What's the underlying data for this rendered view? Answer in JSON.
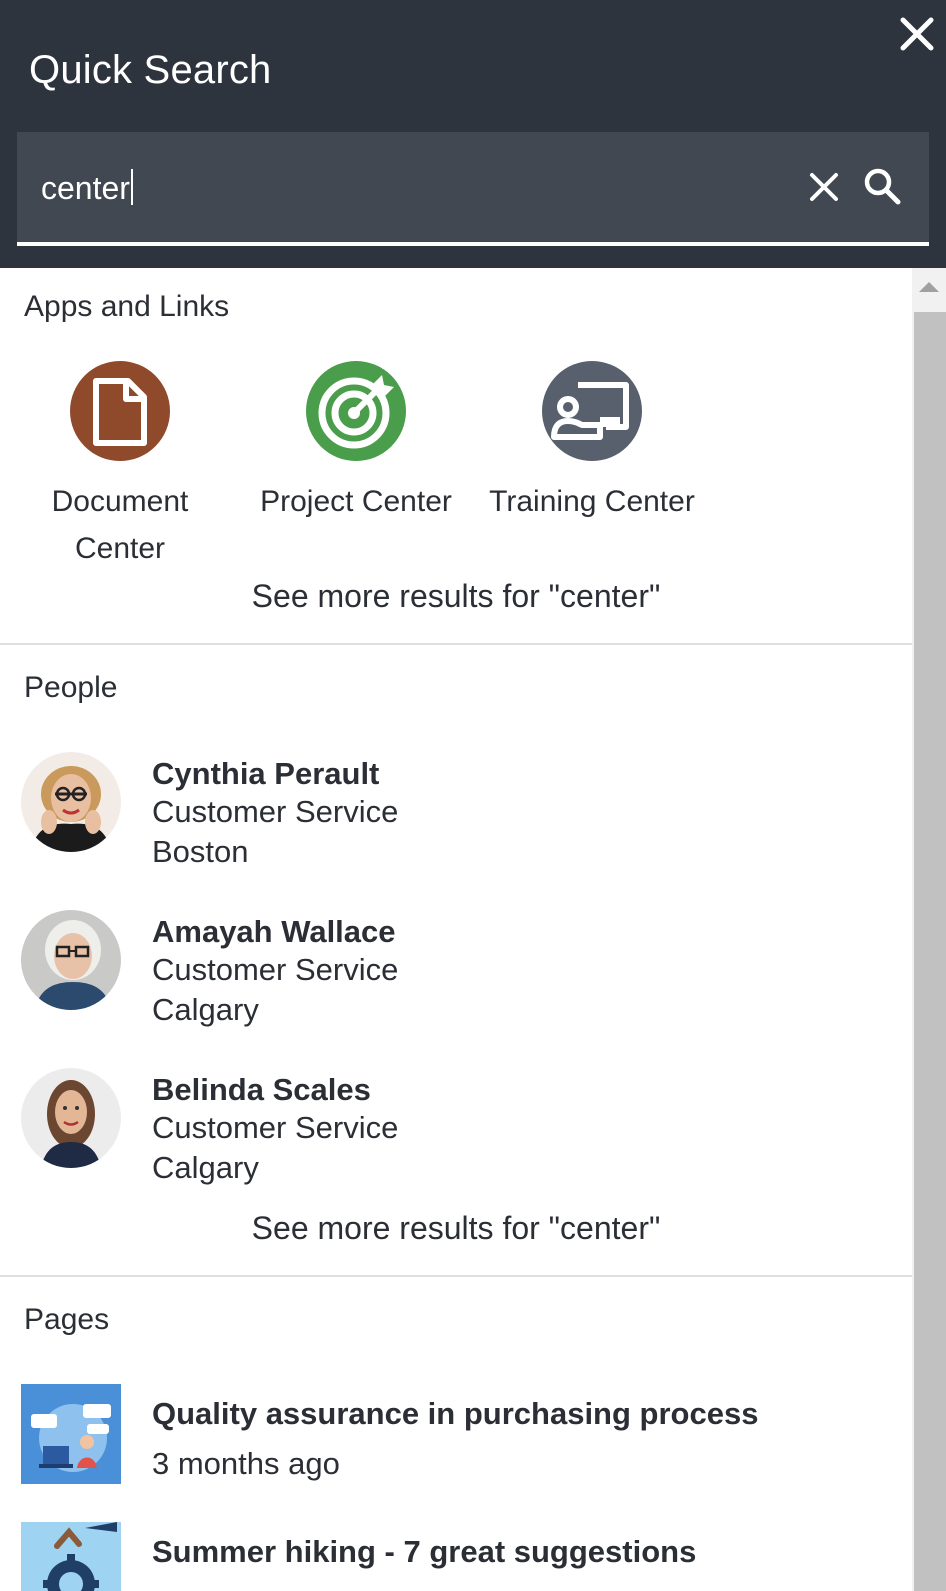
{
  "header": {
    "title": "Quick Search"
  },
  "search": {
    "value": "center"
  },
  "apps_section": {
    "title": "Apps and Links",
    "apps": [
      {
        "label": "Document Center",
        "label_line1": "Document",
        "label_line2": "Center",
        "icon": "document-icon",
        "color": "#8f4a2c"
      },
      {
        "label": "Project Center",
        "icon": "target-icon",
        "color": "#4a9d4a"
      },
      {
        "label": "Training Center",
        "icon": "presentation-icon",
        "color": "#57606c"
      }
    ],
    "more_link": "See more results for \"center\""
  },
  "people_section": {
    "title": "People",
    "people": [
      {
        "name": "Cynthia Perault",
        "department": "Customer Service",
        "location": "Boston"
      },
      {
        "name": "Amayah Wallace",
        "department": "Customer Service",
        "location": "Calgary"
      },
      {
        "name": "Belinda Scales",
        "department": "Customer Service",
        "location": "Calgary"
      }
    ],
    "more_link": "See more results for \"center\""
  },
  "pages_section": {
    "title": "Pages",
    "pages": [
      {
        "title": "Quality assurance in purchasing process",
        "date": "3 months ago"
      },
      {
        "title": "Summer hiking - 7 great suggestions",
        "date": ""
      }
    ]
  },
  "colors": {
    "header_bg": "#2e343d",
    "search_bg": "#414852",
    "text": "#2b2f35",
    "divider": "#dedfe1"
  }
}
